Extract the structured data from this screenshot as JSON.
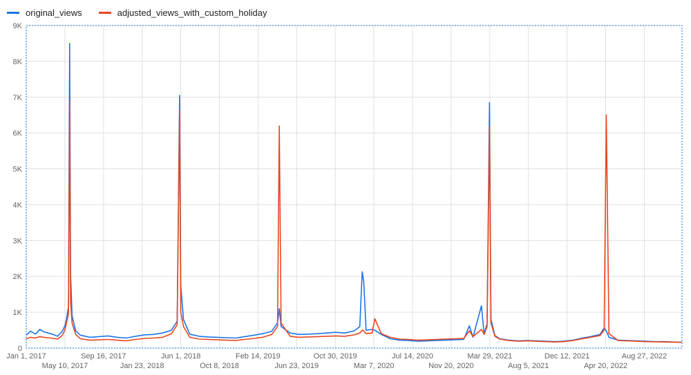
{
  "chart_data": {
    "type": "line",
    "title": "",
    "xlabel": "",
    "ylabel": "",
    "ylim": [
      0,
      9000
    ],
    "grid": true,
    "legend_placement": "top-left",
    "y_ticks": [
      0,
      1000,
      2000,
      3000,
      4000,
      5000,
      6000,
      7000,
      8000,
      9000
    ],
    "y_tick_labels": [
      "0",
      "1K",
      "2K",
      "3K",
      "4K",
      "5K",
      "6K",
      "7K",
      "8K",
      "9K"
    ],
    "x_range": [
      "2017-01-01",
      "2022-12-31"
    ],
    "x_ticks": [
      {
        "date": "2017-01-01",
        "label": "Jan 1, 2017",
        "row": 0
      },
      {
        "date": "2017-05-10",
        "label": "May 10, 2017",
        "row": 1
      },
      {
        "date": "2017-09-16",
        "label": "Sep 16, 2017",
        "row": 0
      },
      {
        "date": "2018-01-23",
        "label": "Jan 23, 2018",
        "row": 1
      },
      {
        "date": "2018-06-01",
        "label": "Jun 1, 2018",
        "row": 0
      },
      {
        "date": "2018-10-08",
        "label": "Oct 8, 2018",
        "row": 1
      },
      {
        "date": "2019-02-14",
        "label": "Feb 14, 2019",
        "row": 0
      },
      {
        "date": "2019-06-23",
        "label": "Jun 23, 2019",
        "row": 1
      },
      {
        "date": "2019-10-30",
        "label": "Oct 30, 2019",
        "row": 0
      },
      {
        "date": "2020-03-07",
        "label": "Mar 7, 2020",
        "row": 1
      },
      {
        "date": "2020-07-14",
        "label": "Jul 14, 2020",
        "row": 0
      },
      {
        "date": "2020-11-20",
        "label": "Nov 20, 2020",
        "row": 1
      },
      {
        "date": "2021-03-29",
        "label": "Mar 29, 2021",
        "row": 0
      },
      {
        "date": "2021-08-05",
        "label": "Aug 5, 2021",
        "row": 1
      },
      {
        "date": "2021-12-12",
        "label": "Dec 12, 2021",
        "row": 0
      },
      {
        "date": "2022-04-20",
        "label": "Apr 20, 2022",
        "row": 1
      },
      {
        "date": "2022-08-27",
        "label": "Aug 27, 2022",
        "row": 0
      }
    ],
    "series": [
      {
        "name": "original_views",
        "color": "#1a73e8",
        "points": [
          [
            "2017-01-01",
            360
          ],
          [
            "2017-01-15",
            470
          ],
          [
            "2017-02-01",
            390
          ],
          [
            "2017-02-15",
            520
          ],
          [
            "2017-03-01",
            450
          ],
          [
            "2017-03-15",
            420
          ],
          [
            "2017-04-01",
            380
          ],
          [
            "2017-04-15",
            330
          ],
          [
            "2017-05-01",
            460
          ],
          [
            "2017-05-10",
            620
          ],
          [
            "2017-05-15",
            800
          ],
          [
            "2017-05-22",
            1150
          ],
          [
            "2017-05-26",
            8500
          ],
          [
            "2017-05-29",
            2100
          ],
          [
            "2017-06-03",
            900
          ],
          [
            "2017-06-15",
            480
          ],
          [
            "2017-07-01",
            360
          ],
          [
            "2017-08-01",
            300
          ],
          [
            "2017-09-01",
            320
          ],
          [
            "2017-10-01",
            340
          ],
          [
            "2017-11-01",
            300
          ],
          [
            "2017-12-01",
            280
          ],
          [
            "2018-01-01",
            330
          ],
          [
            "2018-02-01",
            370
          ],
          [
            "2018-03-01",
            380
          ],
          [
            "2018-04-01",
            420
          ],
          [
            "2018-05-01",
            500
          ],
          [
            "2018-05-20",
            750
          ],
          [
            "2018-05-28",
            7050
          ],
          [
            "2018-06-01",
            1750
          ],
          [
            "2018-06-10",
            800
          ],
          [
            "2018-07-01",
            390
          ],
          [
            "2018-08-01",
            330
          ],
          [
            "2018-09-01",
            310
          ],
          [
            "2018-10-01",
            300
          ],
          [
            "2018-11-01",
            290
          ],
          [
            "2018-12-01",
            280
          ],
          [
            "2019-01-01",
            320
          ],
          [
            "2019-02-01",
            360
          ],
          [
            "2019-03-01",
            400
          ],
          [
            "2019-04-01",
            470
          ],
          [
            "2019-04-20",
            700
          ],
          [
            "2019-04-26",
            1100
          ],
          [
            "2019-05-02",
            600
          ],
          [
            "2019-06-01",
            420
          ],
          [
            "2019-07-01",
            380
          ],
          [
            "2019-08-01",
            390
          ],
          [
            "2019-09-01",
            400
          ],
          [
            "2019-10-01",
            420
          ],
          [
            "2019-11-01",
            440
          ],
          [
            "2019-12-01",
            420
          ],
          [
            "2020-01-01",
            480
          ],
          [
            "2020-01-20",
            600
          ],
          [
            "2020-01-28",
            2130
          ],
          [
            "2020-02-02",
            1850
          ],
          [
            "2020-02-10",
            500
          ],
          [
            "2020-03-01",
            520
          ],
          [
            "2020-03-10",
            500
          ],
          [
            "2020-04-01",
            380
          ],
          [
            "2020-05-01",
            260
          ],
          [
            "2020-06-01",
            220
          ],
          [
            "2020-07-01",
            210
          ],
          [
            "2020-08-01",
            190
          ],
          [
            "2020-09-01",
            200
          ],
          [
            "2020-10-01",
            210
          ],
          [
            "2020-11-01",
            220
          ],
          [
            "2020-12-01",
            230
          ],
          [
            "2021-01-01",
            240
          ],
          [
            "2021-01-20",
            620
          ],
          [
            "2021-02-01",
            300
          ],
          [
            "2021-03-01",
            1180
          ],
          [
            "2021-03-10",
            400
          ],
          [
            "2021-03-20",
            680
          ],
          [
            "2021-03-28",
            6850
          ],
          [
            "2021-04-02",
            800
          ],
          [
            "2021-04-15",
            350
          ],
          [
            "2021-05-01",
            260
          ],
          [
            "2021-06-01",
            220
          ],
          [
            "2021-07-01",
            200
          ],
          [
            "2021-08-01",
            210
          ],
          [
            "2021-09-01",
            200
          ],
          [
            "2021-10-01",
            190
          ],
          [
            "2021-11-01",
            180
          ],
          [
            "2021-12-01",
            190
          ],
          [
            "2022-01-01",
            220
          ],
          [
            "2022-02-01",
            280
          ],
          [
            "2022-03-01",
            320
          ],
          [
            "2022-04-01",
            380
          ],
          [
            "2022-04-15",
            560
          ],
          [
            "2022-04-22",
            480
          ],
          [
            "2022-05-01",
            300
          ],
          [
            "2022-06-01",
            220
          ],
          [
            "2022-07-01",
            210
          ],
          [
            "2022-08-01",
            200
          ],
          [
            "2022-09-01",
            190
          ],
          [
            "2022-10-01",
            180
          ],
          [
            "2022-11-01",
            180
          ],
          [
            "2022-12-01",
            170
          ],
          [
            "2022-12-31",
            160
          ]
        ]
      },
      {
        "name": "adjusted_views_with_custom_holiday",
        "color": "#e8461e",
        "points": [
          [
            "2017-01-01",
            260
          ],
          [
            "2017-01-15",
            300
          ],
          [
            "2017-02-01",
            280
          ],
          [
            "2017-02-15",
            320
          ],
          [
            "2017-03-01",
            300
          ],
          [
            "2017-03-15",
            290
          ],
          [
            "2017-04-01",
            270
          ],
          [
            "2017-04-15",
            250
          ],
          [
            "2017-05-01",
            350
          ],
          [
            "2017-05-10",
            500
          ],
          [
            "2017-05-15",
            700
          ],
          [
            "2017-05-22",
            950
          ],
          [
            "2017-05-26",
            6900
          ],
          [
            "2017-05-29",
            1300
          ],
          [
            "2017-06-03",
            700
          ],
          [
            "2017-06-15",
            380
          ],
          [
            "2017-07-01",
            260
          ],
          [
            "2017-08-01",
            220
          ],
          [
            "2017-09-01",
            230
          ],
          [
            "2017-10-01",
            240
          ],
          [
            "2017-11-01",
            220
          ],
          [
            "2017-12-01",
            200
          ],
          [
            "2018-01-01",
            240
          ],
          [
            "2018-02-01",
            270
          ],
          [
            "2018-03-01",
            280
          ],
          [
            "2018-04-01",
            300
          ],
          [
            "2018-05-01",
            400
          ],
          [
            "2018-05-20",
            650
          ],
          [
            "2018-05-28",
            6650
          ],
          [
            "2018-06-01",
            1000
          ],
          [
            "2018-06-10",
            600
          ],
          [
            "2018-07-01",
            300
          ],
          [
            "2018-08-01",
            250
          ],
          [
            "2018-09-01",
            240
          ],
          [
            "2018-10-01",
            230
          ],
          [
            "2018-11-01",
            220
          ],
          [
            "2018-12-01",
            210
          ],
          [
            "2019-01-01",
            240
          ],
          [
            "2019-02-01",
            270
          ],
          [
            "2019-03-01",
            300
          ],
          [
            "2019-04-01",
            380
          ],
          [
            "2019-04-20",
            600
          ],
          [
            "2019-04-26",
            6200
          ],
          [
            "2019-05-02",
            700
          ],
          [
            "2019-06-01",
            330
          ],
          [
            "2019-07-01",
            300
          ],
          [
            "2019-08-01",
            310
          ],
          [
            "2019-09-01",
            320
          ],
          [
            "2019-10-01",
            330
          ],
          [
            "2019-11-01",
            340
          ],
          [
            "2019-12-01",
            330
          ],
          [
            "2020-01-01",
            370
          ],
          [
            "2020-01-20",
            420
          ],
          [
            "2020-01-28",
            500
          ],
          [
            "2020-02-02",
            480
          ],
          [
            "2020-02-10",
            400
          ],
          [
            "2020-03-01",
            420
          ],
          [
            "2020-03-10",
            820
          ],
          [
            "2020-04-01",
            400
          ],
          [
            "2020-05-01",
            300
          ],
          [
            "2020-06-01",
            250
          ],
          [
            "2020-07-01",
            240
          ],
          [
            "2020-08-01",
            220
          ],
          [
            "2020-09-01",
            230
          ],
          [
            "2020-10-01",
            240
          ],
          [
            "2020-11-01",
            250
          ],
          [
            "2020-12-01",
            260
          ],
          [
            "2021-01-01",
            270
          ],
          [
            "2021-01-20",
            480
          ],
          [
            "2021-02-01",
            320
          ],
          [
            "2021-03-01",
            520
          ],
          [
            "2021-03-10",
            380
          ],
          [
            "2021-03-20",
            600
          ],
          [
            "2021-03-28",
            6200
          ],
          [
            "2021-04-02",
            700
          ],
          [
            "2021-04-15",
            330
          ],
          [
            "2021-05-01",
            250
          ],
          [
            "2021-06-01",
            210
          ],
          [
            "2021-07-01",
            190
          ],
          [
            "2021-08-01",
            200
          ],
          [
            "2021-09-01",
            190
          ],
          [
            "2021-10-01",
            180
          ],
          [
            "2021-11-01",
            170
          ],
          [
            "2021-12-01",
            180
          ],
          [
            "2022-01-01",
            210
          ],
          [
            "2022-02-01",
            260
          ],
          [
            "2022-03-01",
            300
          ],
          [
            "2022-04-01",
            350
          ],
          [
            "2022-04-15",
            500
          ],
          [
            "2022-04-22",
            6500
          ],
          [
            "2022-05-01",
            400
          ],
          [
            "2022-06-01",
            210
          ],
          [
            "2022-07-01",
            200
          ],
          [
            "2022-08-01",
            190
          ],
          [
            "2022-09-01",
            180
          ],
          [
            "2022-10-01",
            175
          ],
          [
            "2022-11-01",
            170
          ],
          [
            "2022-12-01",
            165
          ],
          [
            "2022-12-31",
            160
          ]
        ]
      }
    ]
  }
}
